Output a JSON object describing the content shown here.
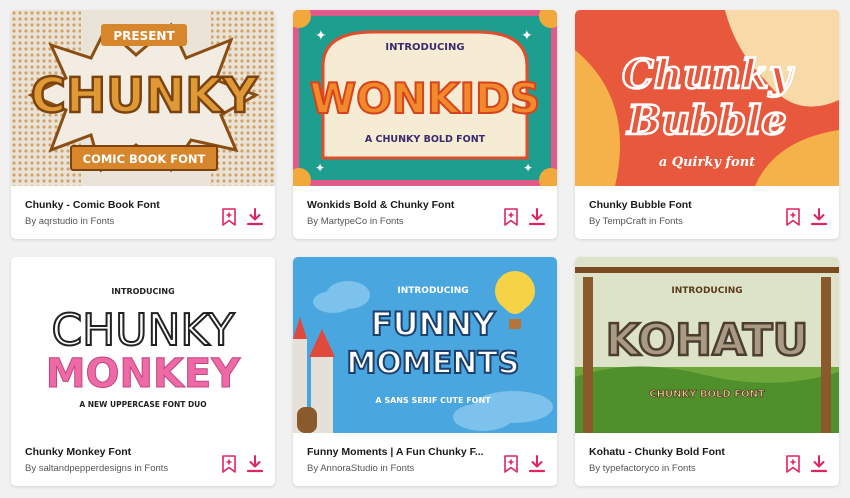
{
  "cards": [
    {
      "title": "Chunky - Comic Book Font",
      "author": "aqrstudio",
      "by": "By",
      "in": "in",
      "category": "Fonts",
      "art": {
        "small": "PRESENT",
        "big": "CHUNKY",
        "sub": "COMIC BOOK FONT"
      }
    },
    {
      "title": "Wonkids Bold & Chunky Font",
      "author": "MartypeCo",
      "by": "By",
      "in": "in",
      "category": "Fonts",
      "art": {
        "small": "INTRODUCING",
        "big": "WONKIDS",
        "sub": "A CHUNKY BOLD FONT"
      }
    },
    {
      "title": "Chunky Bubble Font",
      "author": "TempCraft",
      "by": "By",
      "in": "in",
      "category": "Fonts",
      "art": {
        "line1": "Chunky",
        "line2": "Bubble",
        "sub": "a Quirky font"
      }
    },
    {
      "title": "Chunky Monkey Font",
      "author": "saltandpepperdesigns",
      "by": "By",
      "in": "in",
      "category": "Fonts",
      "art": {
        "small": "INTRODUCING",
        "line1": "CHUNKY",
        "line2": "MONKEY",
        "sub": "A NEW UPPERCASE FONT DUO"
      }
    },
    {
      "title": "Funny Moments | A Fun Chunky F...",
      "author": "AnnoraStudio",
      "by": "By",
      "in": "in",
      "category": "Fonts",
      "art": {
        "small": "INTRODUCING",
        "line1": "FUNNY",
        "line2": "MOMENTS",
        "sub": "A SANS SERIF CUTE FONT"
      }
    },
    {
      "title": "Kohatu - Chunky Bold Font",
      "author": "typefactoryco",
      "by": "By",
      "in": "in",
      "category": "Fonts",
      "art": {
        "small": "INTRODUCING",
        "big": "KOHATU",
        "sub": "CHUNKY BOLD FONT"
      }
    }
  ],
  "icons": {
    "bookmark": "bookmark-add-icon",
    "download": "download-icon"
  },
  "colors": {
    "accent": "#e0245e",
    "card": "#ffffff",
    "page": "#f1f1f1"
  }
}
